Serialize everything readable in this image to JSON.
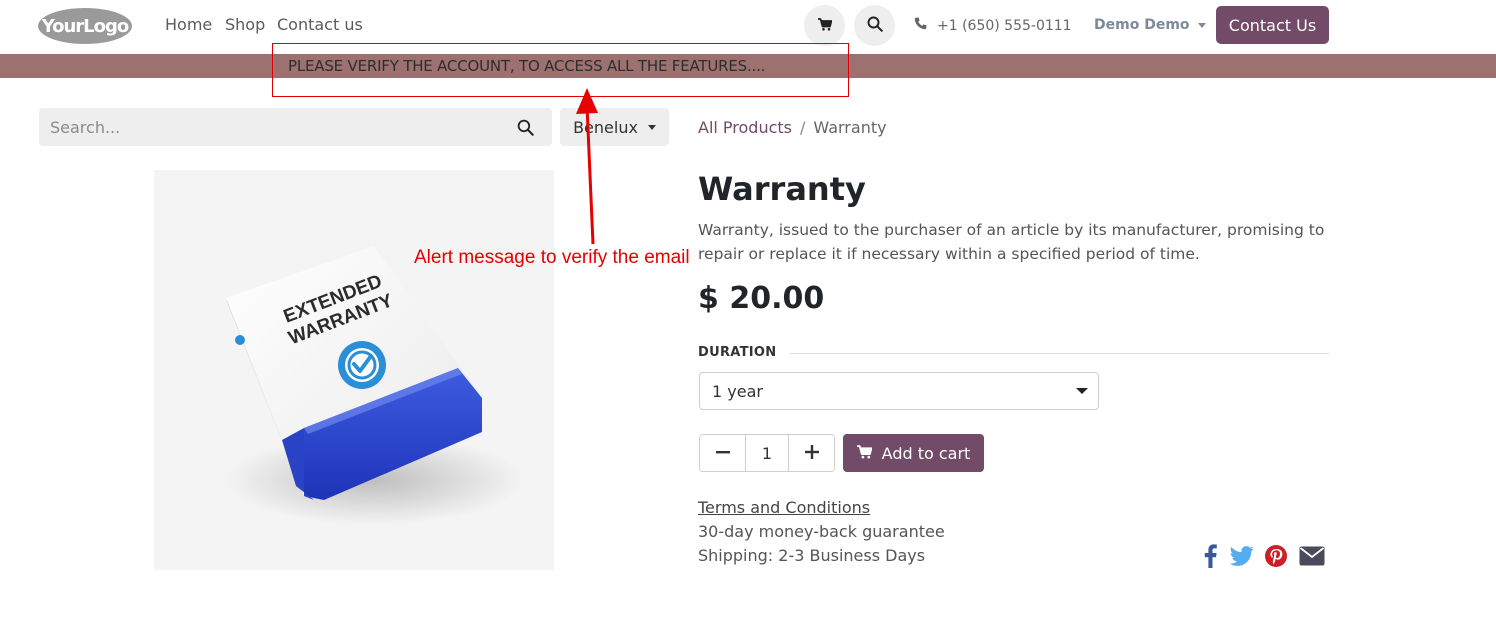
{
  "header": {
    "logo_text": "YourLogo",
    "nav": [
      "Home",
      "Shop",
      "Contact us"
    ],
    "phone": "+1 (650) 555-0111",
    "user": "Demo Demo",
    "contact_button": "Contact Us"
  },
  "banner": {
    "message": "PLEASE VERIFY THE ACCOUNT, TO ACCESS ALL THE FEATURES....",
    "annotation": "Alert message to verify the email"
  },
  "search": {
    "placeholder": "Search...",
    "pricelist": "Benelux"
  },
  "breadcrumb": {
    "parent": "All Products",
    "separator": "/",
    "current": "Warranty"
  },
  "product": {
    "name": "Warranty",
    "description": "Warranty, issued to the purchaser of an article by its manufacturer, promising to repair or replace it if necessary within a specified period of time.",
    "price": "$ 20.00",
    "image_text": "EXTENDED WARRANTY",
    "attribute_label": "DURATION",
    "attribute_value": "1 year",
    "quantity": "1",
    "add_to_cart": "Add to cart",
    "terms": "Terms and Conditions",
    "guarantee": "30-day money-back guarantee",
    "shipping": "Shipping: 2-3 Business Days"
  },
  "colors": {
    "brand": "#714b67",
    "banner": "#9c716f",
    "annotation": "#e00000"
  },
  "icons": {
    "cart": "cart-icon",
    "search": "search-icon",
    "phone": "phone-icon",
    "share": [
      "facebook-icon",
      "twitter-icon",
      "pinterest-icon",
      "envelope-icon"
    ]
  }
}
